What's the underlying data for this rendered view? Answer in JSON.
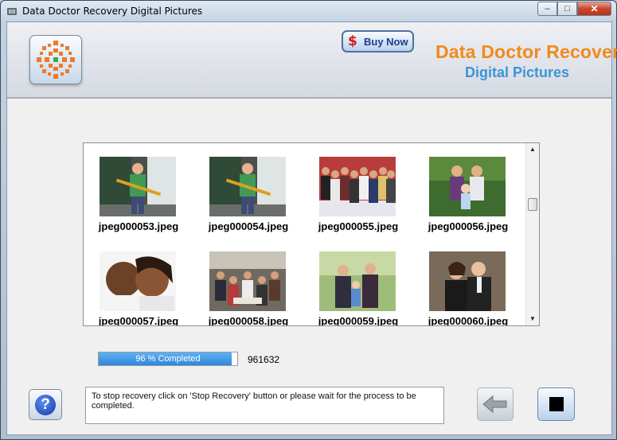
{
  "window": {
    "title": "Data Doctor Recovery Digital Pictures",
    "controls": {
      "minimize": "–",
      "maximize": "□",
      "close": "✕"
    }
  },
  "header": {
    "buy_now_label": "Buy Now",
    "brand_line1": "Data Doctor Recovery",
    "brand_line2": "Digital Pictures",
    "colors": {
      "brand_orange": "#f08a1c",
      "brand_blue": "#3a95d8"
    }
  },
  "gallery": {
    "items": [
      {
        "name": "jpeg000053.jpeg",
        "scene": "man-with-tool"
      },
      {
        "name": "jpeg000054.jpeg",
        "scene": "man-with-tool"
      },
      {
        "name": "jpeg000055.jpeg",
        "scene": "group-photo"
      },
      {
        "name": "jpeg000056.jpeg",
        "scene": "family-baby"
      },
      {
        "name": "jpeg000057.jpeg",
        "scene": "couple-closeup"
      },
      {
        "name": "jpeg000058.jpeg",
        "scene": "group-indoor"
      },
      {
        "name": "jpeg000059.jpeg",
        "scene": "family-outdoor"
      },
      {
        "name": "jpeg000060.jpeg",
        "scene": "couple-formal"
      }
    ]
  },
  "progress": {
    "fraction": 0.96,
    "label": "96 % Completed",
    "count": "961632"
  },
  "footer": {
    "message": "To stop recovery click on 'Stop Recovery' button or please wait for the process to be completed."
  },
  "icons": {
    "help": "help-icon",
    "back": "back-arrow-icon",
    "stop": "stop-icon",
    "logo": "logo-icon",
    "dollar": "dollar-icon"
  }
}
